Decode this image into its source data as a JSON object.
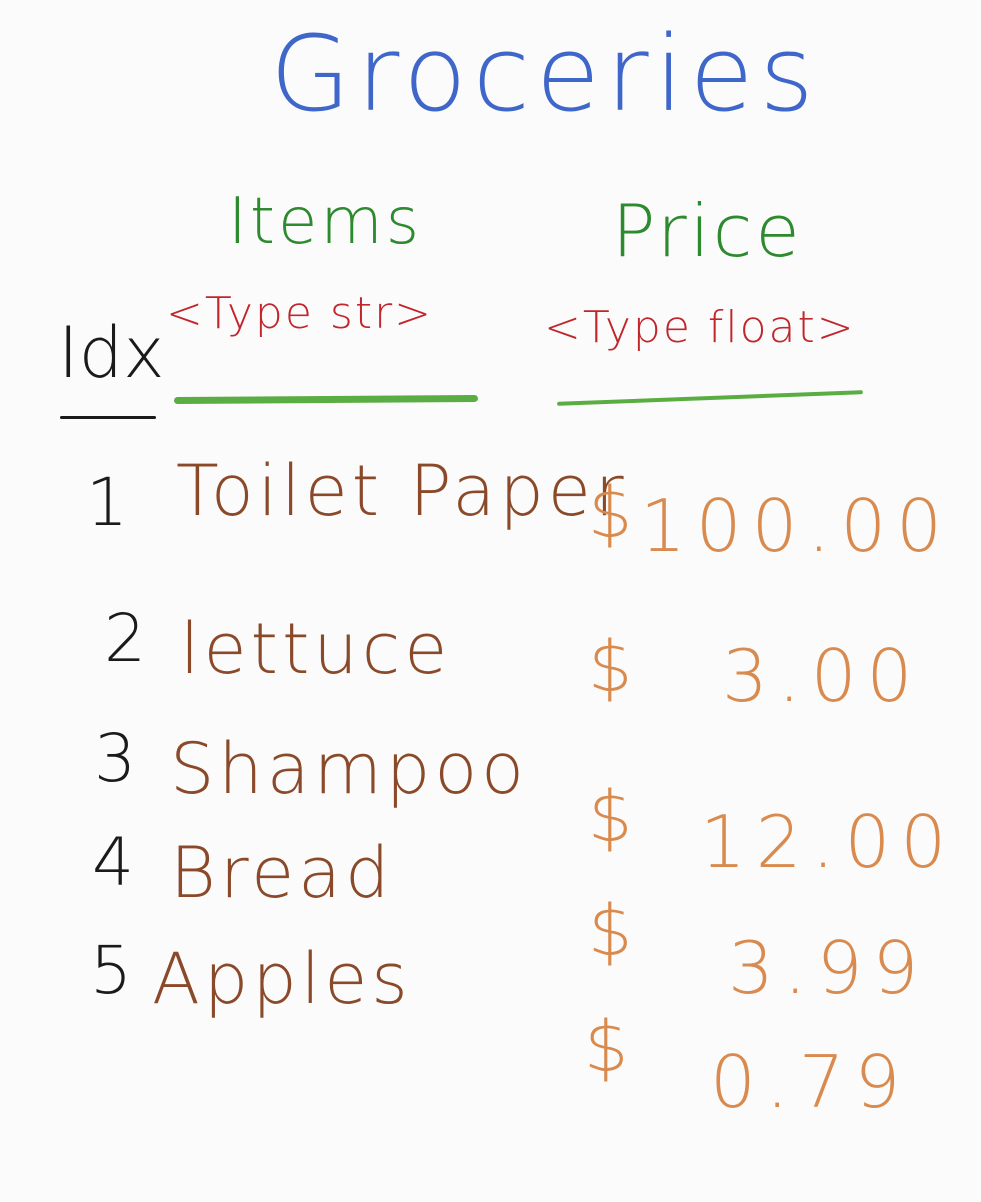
{
  "title": "Groceries",
  "headers": {
    "idx": "Idx",
    "items": "Items",
    "items_type": "<Type str>",
    "price": "Price",
    "price_type": "<Type float>"
  },
  "rows": [
    {
      "idx": "1",
      "item": "Toilet Paper",
      "currency": "$",
      "price": "100.00"
    },
    {
      "idx": "2",
      "item": "lettuce",
      "currency": "$",
      "price": "3.00"
    },
    {
      "idx": "3",
      "item": "Shampoo",
      "currency": "$",
      "price": "12.00"
    },
    {
      "idx": "4",
      "item": "Bread",
      "currency": "$",
      "price": "3.99"
    },
    {
      "idx": "5",
      "item": "Apples",
      "currency": "$",
      "price": "0.79"
    }
  ],
  "colors": {
    "title": "#3f66c9",
    "column_header": "#2e8a2e",
    "type_annotation": "#c0262b",
    "underline": "#5aad42",
    "index": "#1a1a1a",
    "item": "#8a4a2a",
    "price": "#d98a4e"
  }
}
